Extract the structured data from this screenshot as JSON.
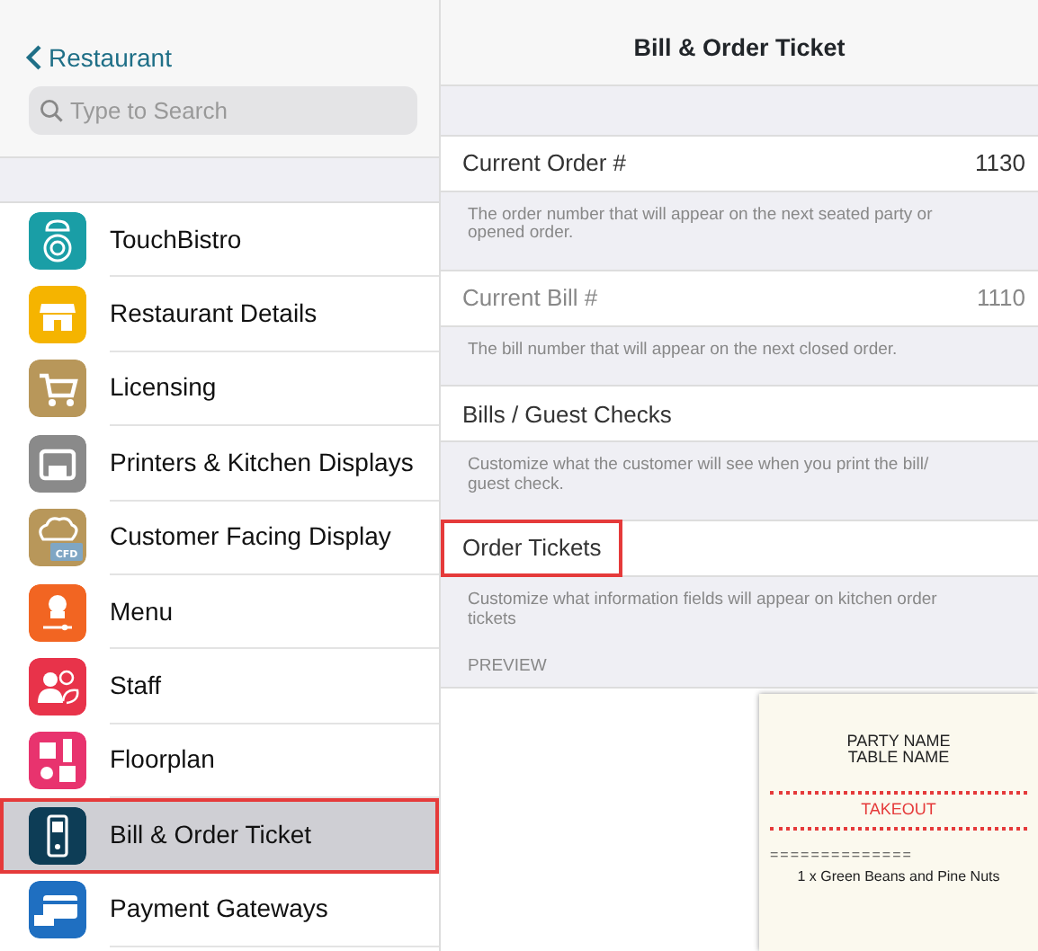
{
  "sidebar": {
    "back": "Restaurant",
    "search": {
      "placeholder": "Type to Search"
    },
    "items": [
      {
        "label": "TouchBistro",
        "kind": "chef",
        "color": "#1a9ea6",
        "selected": false,
        "highlighted": false
      },
      {
        "label": "Restaurant Details",
        "kind": "store",
        "color": "#f5b400",
        "selected": false,
        "highlighted": false
      },
      {
        "label": "Licensing",
        "kind": "cart",
        "color": "#b8975a",
        "selected": false,
        "highlighted": false
      },
      {
        "label": "Printers & Kitchen Displays",
        "kind": "printer",
        "color": "#8a8a8a",
        "selected": false,
        "highlighted": false
      },
      {
        "label": "Customer Facing Display",
        "kind": "cfd",
        "color": "#b8975a",
        "selected": false,
        "highlighted": false,
        "badge": "CFD"
      },
      {
        "label": "Menu",
        "kind": "menu",
        "color": "#f26522",
        "selected": false,
        "highlighted": false
      },
      {
        "label": "Staff",
        "kind": "staff",
        "color": "#e8334a",
        "selected": false,
        "highlighted": false
      },
      {
        "label": "Floorplan",
        "kind": "floor",
        "color": "#e8336e",
        "selected": false,
        "highlighted": false
      },
      {
        "label": "Bill & Order Ticket",
        "kind": "terminal",
        "color": "#0d3d56",
        "selected": true,
        "highlighted": true
      },
      {
        "label": "Payment Gateways",
        "kind": "card",
        "color": "#1f6fc1",
        "selected": false,
        "highlighted": false
      }
    ]
  },
  "detail": {
    "title": "Bill & Order Ticket",
    "rows": [
      {
        "label": "Current Order #",
        "value": "1130",
        "disabled": false,
        "highlighted": false,
        "description": "The order number that will appear on the next seated party or opened order."
      },
      {
        "label": "Current Bill #",
        "value": "1110",
        "disabled": true,
        "highlighted": false,
        "description": "The bill number that will appear on the next closed order."
      },
      {
        "label": "Bills / Guest Checks",
        "disabled": false,
        "highlighted": false,
        "description": "Customize what the customer will see when you print the bill/ guest check."
      },
      {
        "label": "Order Tickets",
        "disabled": false,
        "highlighted": true,
        "description": "Customize what information fields will appear on kitchen order tickets"
      }
    ],
    "preview_label": "PREVIEW",
    "ticket": [
      {
        "kind": "heading",
        "text": "PARTY NAME"
      },
      {
        "kind": "heading",
        "text": "TABLE NAME"
      },
      {
        "kind": "banner",
        "text": "TAKEOUT"
      },
      {
        "kind": "rule",
        "text": "=============="
      },
      {
        "kind": "item",
        "text": "1 x Green Beans and Pine Nuts"
      }
    ]
  }
}
